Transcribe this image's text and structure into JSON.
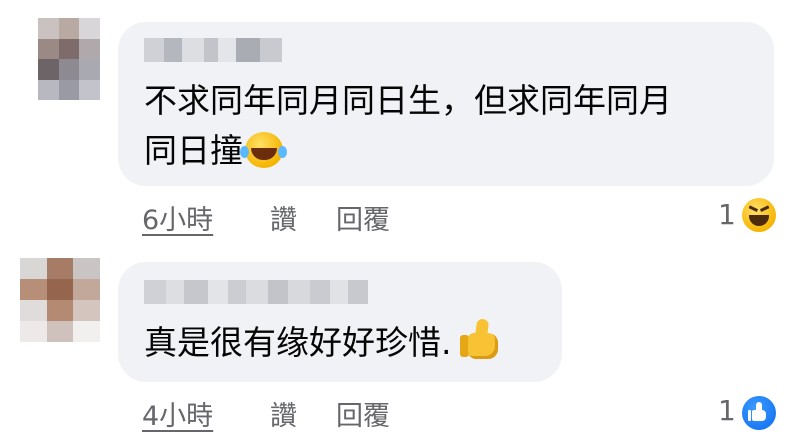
{
  "comments": [
    {
      "text_lines": [
        "不求同年同月同日生，但求同年同月",
        "同日撞"
      ],
      "emoji": "grinning-squinting-tears-emoji",
      "time": "6小時",
      "like_label": "讚",
      "reply_label": "回覆",
      "reaction_count": "1",
      "reaction_icon": "haha-reaction-icon"
    },
    {
      "text_lines": [
        "真是很有缘好好珍惜."
      ],
      "emoji": "thumbs-up-emoji",
      "time": "4小時",
      "like_label": "讚",
      "reply_label": "回覆",
      "reaction_count": "1",
      "reaction_icon": "like-reaction-icon"
    }
  ],
  "colors": {
    "bubble": "#f0f2f5",
    "text": "#050505",
    "meta": "#65676b",
    "like_blue": "#1877f2",
    "haha_yellow": "#f5b400"
  }
}
